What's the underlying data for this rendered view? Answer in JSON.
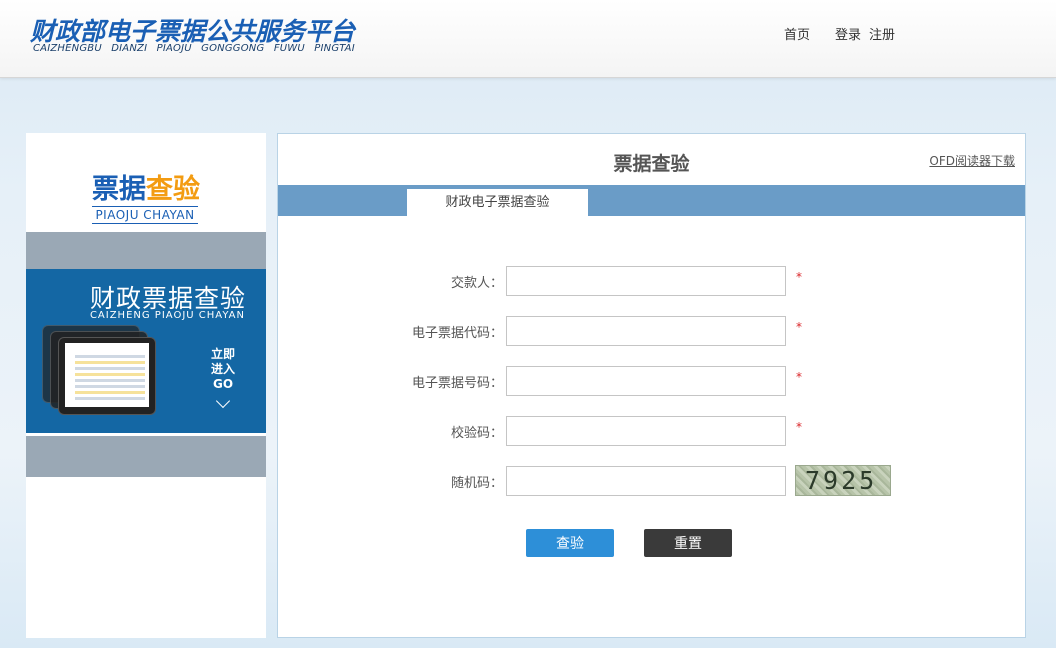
{
  "header": {
    "logo_title": "财政部电子票据公共服务平台",
    "logo_subtitle": "CAIZHENGBU  DIANZI  PIAOJU  GONGGONG  FUWU  PINGTAI",
    "nav": {
      "home": "首页",
      "login": "登录",
      "register": "注册"
    }
  },
  "sidebar": {
    "title_part1": "票据",
    "title_part2": "查验",
    "title_pinyin": "PIAOJU  CHAYAN",
    "banner_title": "财政票据查验",
    "banner_pinyin": "CAIZHENG PIAOJU CHAYAN",
    "enter_line1": "立即",
    "enter_line2": "进入",
    "enter_line3": "GO"
  },
  "main": {
    "title": "票据查验",
    "ofd_link": "OFD阅读器下载",
    "tab": "财政电子票据查验",
    "fields": {
      "payer": {
        "label": "交款人：",
        "value": "",
        "required": "*"
      },
      "code": {
        "label": "电子票据代码：",
        "value": "",
        "required": "*"
      },
      "number": {
        "label": "电子票据号码：",
        "value": "",
        "required": "*"
      },
      "checkcode": {
        "label": "校验码：",
        "value": "",
        "required": "*"
      },
      "random": {
        "label": "随机码：",
        "value": ""
      }
    },
    "captcha_text": "7925",
    "buttons": {
      "check": "查验",
      "reset": "重置"
    }
  },
  "colors": {
    "brand_blue": "#1a5fb4",
    "accent_orange": "#f39c12",
    "tabbar": "#6a9cc7",
    "check_button": "#2d8fd8",
    "reset_button": "#3a3a3a",
    "required": "#d9262a"
  }
}
